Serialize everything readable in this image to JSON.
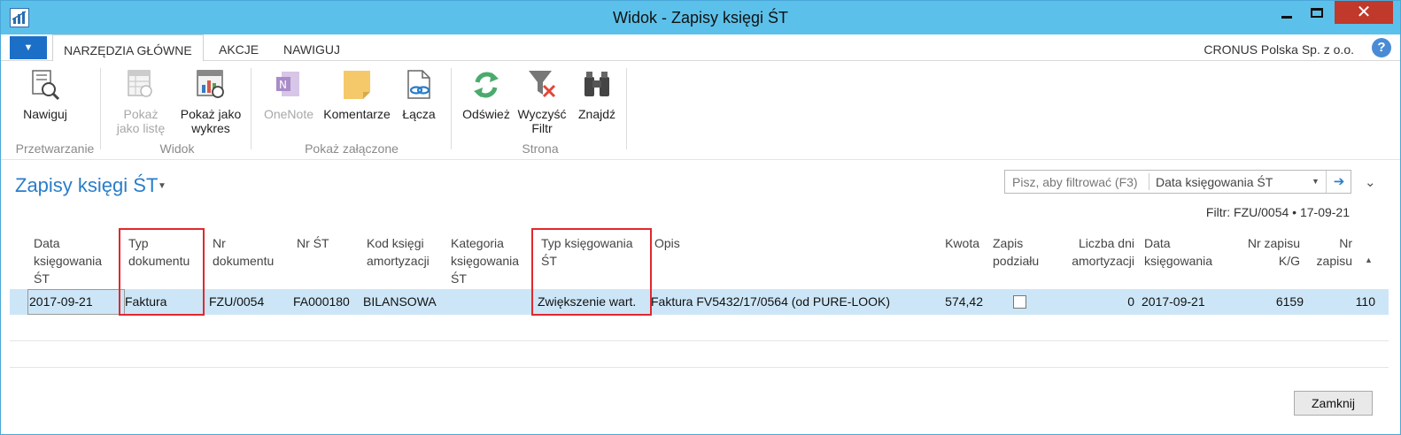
{
  "window": {
    "title": "Widok - Zapisy księgi ŚT",
    "minimize_icon": "minimize-icon",
    "maximize_icon": "maximize-icon",
    "close_icon": "close-icon"
  },
  "ribbon_tabs": {
    "menu_icon": "dropdown-menu-icon",
    "tabs": [
      "NARZĘDZIA GŁÓWNE",
      "AKCJE",
      "NAWIGUJ"
    ],
    "active_tab": "NARZĘDZIA GŁÓWNE",
    "company": "CRONUS Polska Sp. z o.o.",
    "help_icon": "?"
  },
  "ribbon": {
    "groups": {
      "przetwarzanie": "Przetwarzanie",
      "widok": "Widok",
      "zalaczone": "Pokaż załączone",
      "strona": "Strona"
    },
    "buttons": {
      "nawiguj": "Nawiguj",
      "pokaz_liste_1": "Pokaż",
      "pokaz_liste_2": "jako listę",
      "pokaz_wykres_1": "Pokaż jako",
      "pokaz_wykres_2": "wykres",
      "onenote": "OneNote",
      "komentarze": "Komentarze",
      "lacza": "Łącza",
      "odswiez": "Odśwież",
      "wyczysc_1": "Wyczyść",
      "wyczysc_2": "Filtr",
      "znajdz": "Znajdź"
    }
  },
  "page": {
    "title": "Zapisy księgi ŚT",
    "search_placeholder": "Pisz, aby filtrować (F3)",
    "search_field": "Data księgowania ŚT",
    "filter_info": "Filtr: FZU/0054 • 17-09-21",
    "close_button": "Zamknij"
  },
  "columns": {
    "data_ksiegowania_st": [
      "Data",
      "księgowania",
      "ŚT"
    ],
    "typ_dokumentu": [
      "Typ",
      "dokumentu"
    ],
    "nr_dokumentu": [
      "Nr",
      "dokumentu"
    ],
    "nr_st": [
      "Nr ŚT"
    ],
    "kod_ksiegi": [
      "Kod księgi",
      "amortyzacji"
    ],
    "kategoria": [
      "Kategoria",
      "księgowania",
      "ŚT"
    ],
    "typ_ksiegowania": [
      "Typ księgowania",
      "ŚT"
    ],
    "opis": [
      "Opis"
    ],
    "kwota": [
      "Kwota"
    ],
    "zapis_podzialu": [
      "Zapis",
      "podziału"
    ],
    "liczba_dni": [
      "Liczba dni",
      "amortyzacji"
    ],
    "data_ksiegowania": [
      "Data",
      "księgowania"
    ],
    "nr_zapisu_kg": [
      "Nr zapisu",
      "K/G"
    ],
    "nr_zapisu": [
      "Nr",
      "zapisu"
    ]
  },
  "rows": [
    {
      "data_ksiegowania_st": "2017-09-21",
      "typ_dokumentu": "Faktura",
      "nr_dokumentu": "FZU/0054",
      "nr_st": "FA000180",
      "kod_ksiegi": "BILANSOWA",
      "kategoria": "",
      "typ_ksiegowania": "Zwiększenie wart.",
      "opis": "Faktura FV5432/17/0564 (od PURE-LOOK)",
      "kwota": "574,42",
      "zapis_podzialu": false,
      "liczba_dni": "0",
      "data_ksiegowania": "2017-09-21",
      "nr_zapisu_kg": "6159",
      "nr_zapisu": "110"
    }
  ],
  "colors": {
    "titlebar": "#5cc1ea",
    "accent": "#2a7dc9",
    "selected_row": "#cde6f7",
    "highlight_box": "#e0282e"
  }
}
